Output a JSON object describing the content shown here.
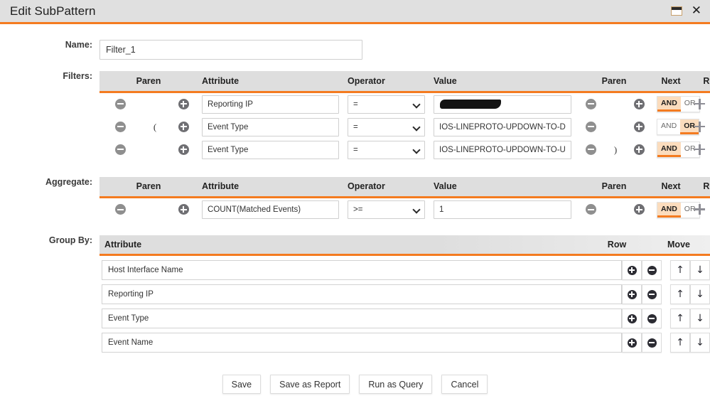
{
  "window": {
    "title": "Edit SubPattern",
    "maximize_icon": "maximize-icon",
    "close_icon": "close-icon",
    "close_glyph": "✕",
    "accent_color": "#f47b20",
    "titlebar_bg": "#e0e0e0"
  },
  "name_field": {
    "label": "Name:",
    "value": "Filter_1",
    "placeholder": ""
  },
  "filters": {
    "label": "Filters:",
    "columns": [
      "Paren",
      "Attribute",
      "Operator",
      "Value",
      "Paren",
      "Next",
      "Row"
    ],
    "rows": [
      {
        "paren_left": "",
        "attribute": "Reporting IP",
        "operator": "=",
        "value": "",
        "value_redacted": true,
        "paren_right": "",
        "next": "AND"
      },
      {
        "paren_left": "(",
        "attribute": "Event Type",
        "operator": "=",
        "value": "IOS-LINEPROTO-UPDOWN-TO-DOWN",
        "value_redacted": false,
        "paren_right": "",
        "next": "OR"
      },
      {
        "paren_left": "",
        "attribute": "Event Type",
        "operator": "=",
        "value": "IOS-LINEPROTO-UPDOWN-TO-UP",
        "value_redacted": false,
        "paren_right": ")",
        "next": "AND"
      }
    ],
    "toggle_options": [
      "AND",
      "OR"
    ]
  },
  "aggregate": {
    "label": "Aggregate:",
    "columns": [
      "Paren",
      "Attribute",
      "Operator",
      "Value",
      "Paren",
      "Next",
      "Row"
    ],
    "rows": [
      {
        "paren_left": "",
        "attribute": "COUNT(Matched Events)",
        "operator": ">=",
        "value": "1",
        "paren_right": "",
        "next": "AND"
      }
    ],
    "toggle_options": [
      "AND",
      "OR"
    ]
  },
  "group_by": {
    "label": "Group By:",
    "columns": {
      "attribute": "Attribute",
      "row": "Row",
      "move": "Move"
    },
    "rows": [
      {
        "attribute": "Host Interface Name"
      },
      {
        "attribute": "Reporting IP"
      },
      {
        "attribute": "Event Type"
      },
      {
        "attribute": "Event Name"
      }
    ],
    "icons": {
      "add": "circle-plus-icon",
      "remove": "circle-minus-icon",
      "up": "arrow-up-icon",
      "down": "arrow-down-icon",
      "up_glyph": "↑",
      "down_glyph": "↓"
    }
  },
  "footer": {
    "buttons": [
      {
        "label": "Save",
        "name": "save-button"
      },
      {
        "label": "Save as Report",
        "name": "save-as-report-button"
      },
      {
        "label": "Run as Query",
        "name": "run-as-query-button"
      },
      {
        "label": "Cancel",
        "name": "cancel-button"
      }
    ]
  }
}
